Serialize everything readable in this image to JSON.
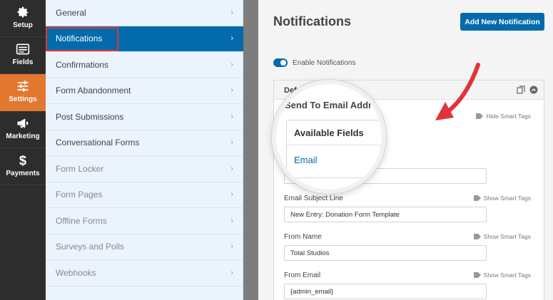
{
  "rail": {
    "items": [
      {
        "label": "Setup",
        "icon": "gear-icon"
      },
      {
        "label": "Fields",
        "icon": "list-icon"
      },
      {
        "label": "Settings",
        "icon": "sliders-icon",
        "active": true
      },
      {
        "label": "Marketing",
        "icon": "megaphone-icon"
      },
      {
        "label": "Payments",
        "icon": "dollar-icon"
      }
    ]
  },
  "subnav": {
    "items": [
      {
        "label": "General"
      },
      {
        "label": "Notifications",
        "active": true
      },
      {
        "label": "Confirmations"
      },
      {
        "label": "Form Abandonment"
      },
      {
        "label": "Post Submissions"
      },
      {
        "label": "Conversational Forms"
      },
      {
        "label": "Form Locker",
        "muted": true
      },
      {
        "label": "Form Pages",
        "muted": true
      },
      {
        "label": "Offline Forms",
        "muted": true
      },
      {
        "label": "Surveys and Polls",
        "muted": true
      },
      {
        "label": "Webhooks",
        "muted": true
      }
    ]
  },
  "main": {
    "title": "Notifications",
    "add_button": "Add New Notification",
    "enable_label": "Enable Notifications",
    "panel": {
      "title_partial": "Defa",
      "send_to_tags": "Hide Smart Tags",
      "send_to_value_partial": "{a",
      "subject_label": "Email Subject Line",
      "subject_tags": "Show Smart Tags",
      "subject_value": "New Entry: Donation Form Template",
      "from_name_label": "From Name",
      "from_name_tags": "Show Smart Tags",
      "from_name_value": "Total Studios",
      "from_email_label": "From Email",
      "from_email_tags": "Show Smart Tags",
      "from_email_value": "{admin_email}"
    },
    "magnifier": {
      "heading": "Send To Email Addr",
      "box_title": "Available Fields",
      "box_item": "Email"
    }
  },
  "colors": {
    "accent": "#036aab",
    "settings_active": "#e27730",
    "highlight_outline": "#e0343a",
    "arrow": "#e0343a"
  }
}
